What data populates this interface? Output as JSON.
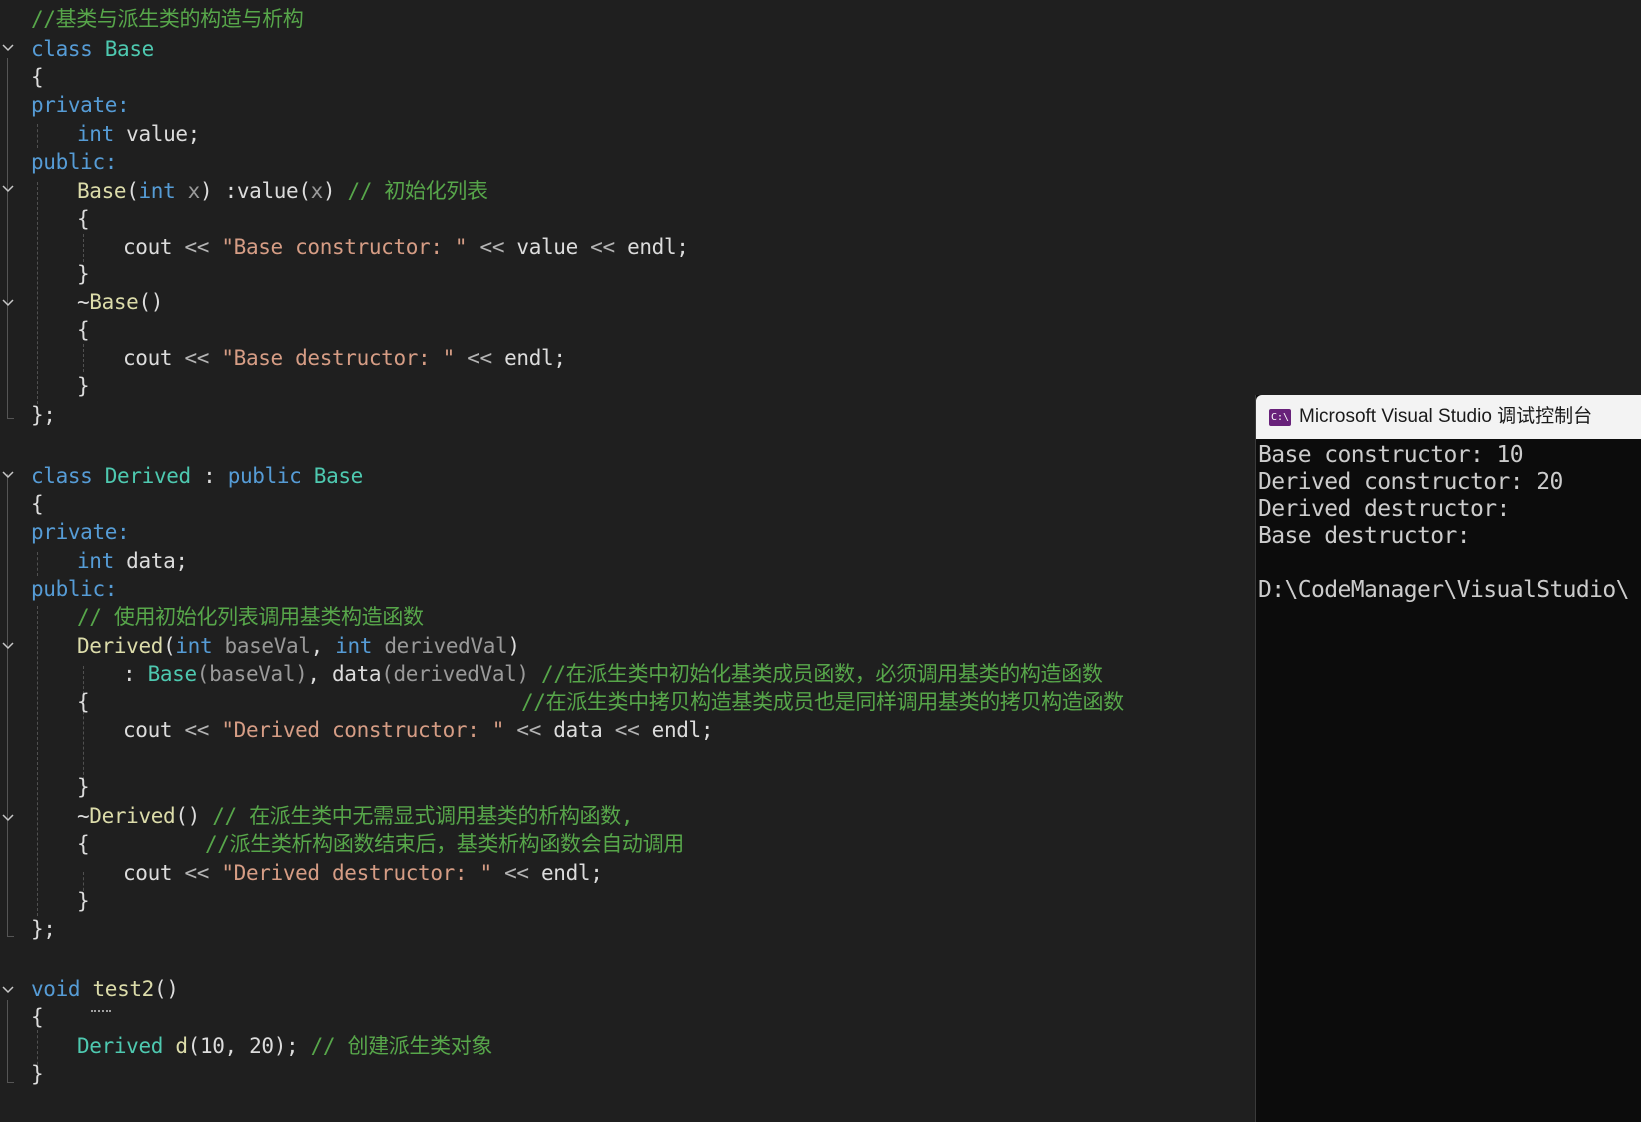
{
  "editor": {
    "comment_header": "//基类与派生类的构造与析构",
    "base_class": {
      "kw_class": "class",
      "name": "Base",
      "open_brace": "{",
      "private_label": "private:",
      "member_type": "int",
      "member_name": " value;",
      "public_label": "public:",
      "ctor_name": "Base",
      "ctor_params_open": "(",
      "ctor_param_type": "int",
      "ctor_param_name": " x",
      "ctor_params_close": ") ",
      "ctor_init": ":value(",
      "ctor_init_arg": "x",
      "ctor_init_close": ") ",
      "ctor_comment": "// 初始化列表",
      "ctor_open": "{",
      "ctor_cout": "cout ",
      "ctor_op1": "<< ",
      "ctor_string": "\"Base constructor: \"",
      "ctor_op2": " << ",
      "ctor_value": "value",
      "ctor_op3": " << ",
      "ctor_endl": "endl",
      "ctor_semi": ";",
      "ctor_close": "}",
      "dtor_tilde": "~",
      "dtor_name": "Base",
      "dtor_parens": "()",
      "dtor_open": "{",
      "dtor_cout": "cout ",
      "dtor_op1": "<< ",
      "dtor_string": "\"Base destructor: \"",
      "dtor_op2": " << ",
      "dtor_endl": "endl",
      "dtor_semi": ";",
      "dtor_close": "}",
      "close": "};"
    },
    "derived_class": {
      "kw_class": "class",
      "name": "Derived",
      "colon": " : ",
      "kw_public": "public",
      "base_name": "Base",
      "open_brace": "{",
      "private_label": "private:",
      "member_type": "int",
      "member_name": " data;",
      "public_label": "public:",
      "init_comment": "// 使用初始化列表调用基类构造函数",
      "ctor_name": "Derived",
      "ctor_open_paren": "(",
      "ctor_p1_type": "int",
      "ctor_p1_name": " baseVal",
      "ctor_comma": ", ",
      "ctor_p2_type": "int",
      "ctor_p2_name": " derivedVal",
      "ctor_close_paren": ")",
      "init_colon": ": ",
      "init_base": "Base",
      "init_base_arg": "(baseVal)",
      "init_comma": ", ",
      "init_data": "data",
      "init_data_arg": "(derivedVal)",
      "init_line_comment": " //在派生类中初始化基类成员函数，必须调用基类的构造函数",
      "ctor_body_open": "{",
      "copy_comment": "//在派生类中拷贝构造基类成员也是同样调用基类的拷贝构造函数",
      "ctor_cout": "cout ",
      "ctor_op1": "<< ",
      "ctor_string": "\"Derived constructor: \"",
      "ctor_op2": " << ",
      "ctor_data": "data",
      "ctor_op3": " << ",
      "ctor_endl": "endl",
      "ctor_semi": ";",
      "ctor_body_close": "}",
      "dtor_tilde": "~",
      "dtor_name": "Derived",
      "dtor_parens": "()",
      "dtor_comment": " // 在派生类中无需显式调用基类的析构函数,",
      "dtor_open": "{",
      "dtor_comment2": "//派生类析构函数结束后，基类析构函数会自动调用",
      "dtor_cout": "cout ",
      "dtor_op1": "<< ",
      "dtor_string": "\"Derived destructor: \"",
      "dtor_op2": " << ",
      "dtor_endl": "endl",
      "dtor_semi": ";",
      "dtor_close": "}",
      "close": "};"
    },
    "test_fn": {
      "kw_void": "void",
      "name": "test2",
      "parens": "()",
      "open_brace": "{",
      "decl_type": "Derived",
      "decl_var": " d",
      "decl_args": "(10, 20);",
      "decl_comment": " // 创建派生类对象",
      "close_brace": "}"
    }
  },
  "console": {
    "icon_text": "C:\\",
    "title": "Microsoft Visual Studio 调试控制台",
    "lines": [
      "Base constructor: 10",
      "Derived constructor: 20",
      "Derived destructor:",
      "Base destructor:",
      "",
      "D:\\CodeManager\\VisualStudio\\"
    ]
  },
  "colors": {
    "editor_bg": "#1f1f1f",
    "keyword": "#569cd6",
    "type": "#4ec9b0",
    "function": "#dcdcaa",
    "string": "#d69d85",
    "comment": "#57a64a",
    "console_bg": "#0c0c0c"
  }
}
